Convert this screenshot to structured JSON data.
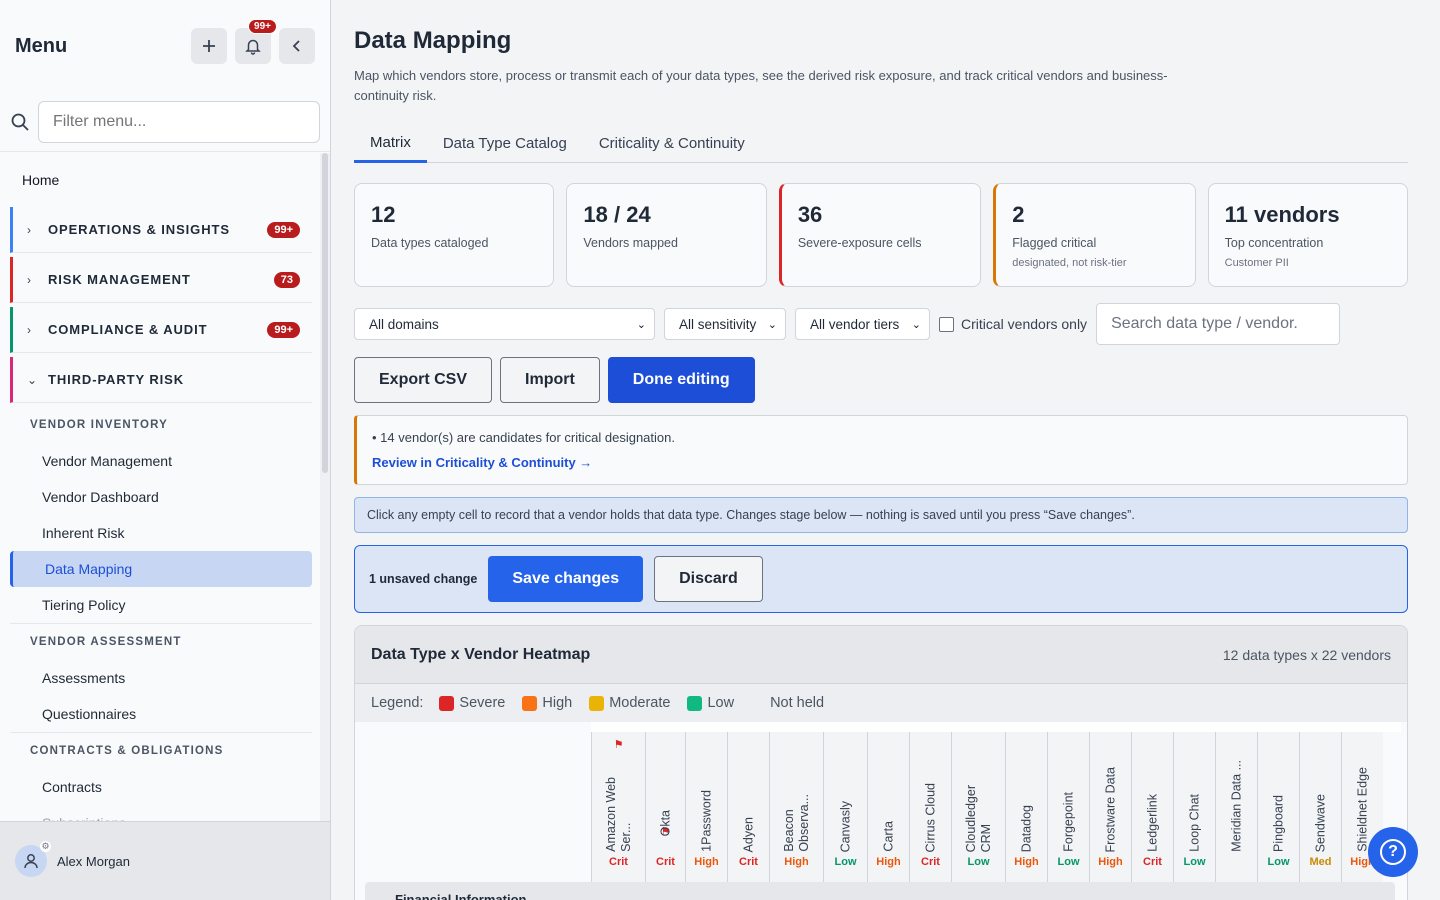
{
  "sidebar": {
    "title": "Menu",
    "notif_badge": "99+",
    "filter_placeholder": "Filter menu...",
    "home": "Home",
    "groups": [
      {
        "label": "OPERATIONS & INSIGHTS",
        "count": "99+",
        "color": "#3b82f6"
      },
      {
        "label": "RISK MANAGEMENT",
        "count": "73",
        "color": "#dc2626"
      },
      {
        "label": "COMPLIANCE & AUDIT",
        "count": "99+",
        "color": "#059669"
      },
      {
        "label": "THIRD-PARTY RISK",
        "count": "",
        "color": "#db2777"
      }
    ],
    "sections": {
      "vendor_inventory": "VENDOR INVENTORY",
      "vendor_assessment": "VENDOR ASSESSMENT",
      "contracts": "CONTRACTS & OBLIGATIONS"
    },
    "items": {
      "vendor_management": "Vendor Management",
      "vendor_dashboard": "Vendor Dashboard",
      "inherent_risk": "Inherent Risk",
      "data_mapping": "Data Mapping",
      "tiering_policy": "Tiering Policy",
      "assessments": "Assessments",
      "questionnaires": "Questionnaires",
      "contracts": "Contracts",
      "subscriptions": "Subscriptions"
    },
    "user": "Alex Morgan"
  },
  "page": {
    "title": "Data Mapping",
    "subtitle": "Map which vendors store, process or transmit each of your data types, see the derived risk exposure, and track critical vendors and business-continuity risk.",
    "tabs": [
      "Matrix",
      "Data Type Catalog",
      "Criticality & Continuity"
    ]
  },
  "stats": [
    {
      "value": "12",
      "label": "Data types cataloged",
      "note": ""
    },
    {
      "value": "18 / 24",
      "label": "Vendors mapped",
      "note": ""
    },
    {
      "value": "36",
      "label": "Severe-exposure cells",
      "note": ""
    },
    {
      "value": "2",
      "label": "Flagged critical",
      "note": "designated, not risk-tier"
    },
    {
      "value": "11 vendors",
      "label": "Top concentration",
      "note": "Customer PII"
    }
  ],
  "filters": {
    "domain": "All domains",
    "sensitivity": "All sensitivity",
    "tiers": "All vendor tiers",
    "critical_only": "Critical vendors only",
    "search_placeholder": "Search data type / vendor."
  },
  "actions": {
    "export": "Export CSV",
    "import": "Import",
    "done": "Done editing"
  },
  "notice": {
    "line": "• 14 vendor(s) are candidates for critical designation.",
    "link": "Review in Criticality & Continuity →"
  },
  "info": "Click any empty cell to record that a vendor holds that data type. Changes stage below — nothing is saved until you press “Save changes”.",
  "unsaved": {
    "label": "1 unsaved change",
    "save": "Save changes",
    "discard": "Discard"
  },
  "heatmap": {
    "title": "Data Type x Vendor Heatmap",
    "meta": "12 data types x 22 vendors",
    "legend_label": "Legend:",
    "legend": [
      {
        "label": "Severe",
        "color": "#dc2626"
      },
      {
        "label": "High",
        "color": "#f97316"
      },
      {
        "label": "Moderate",
        "color": "#eab308"
      },
      {
        "label": "Low",
        "color": "#10b981"
      }
    ],
    "not_held": "Not held",
    "vendors": [
      {
        "name": "Amazon Web\nSer...",
        "tier": "Crit",
        "flag": true
      },
      {
        "name": "Okta",
        "tier": "Crit",
        "flag": true
      },
      {
        "name": "1Password",
        "tier": "High",
        "flag": false
      },
      {
        "name": "Adyen",
        "tier": "Crit",
        "flag": false
      },
      {
        "name": "Beacon\nObserva...",
        "tier": "High",
        "flag": false
      },
      {
        "name": "Canvasly",
        "tier": "Low",
        "flag": false
      },
      {
        "name": "Carta",
        "tier": "High",
        "flag": false
      },
      {
        "name": "Cirrus Cloud",
        "tier": "Crit",
        "flag": false
      },
      {
        "name": "Cloudledger\nCRM",
        "tier": "Low",
        "flag": false
      },
      {
        "name": "Datadog",
        "tier": "High",
        "flag": false
      },
      {
        "name": "Forgepoint",
        "tier": "Low",
        "flag": false
      },
      {
        "name": "Frostware Data",
        "tier": "High",
        "flag": false
      },
      {
        "name": "Ledgerlink",
        "tier": "Crit",
        "flag": false
      },
      {
        "name": "Loop Chat",
        "tier": "Low",
        "flag": false
      },
      {
        "name": "Meridian Data ...",
        "tier": "",
        "flag": false
      },
      {
        "name": "Pingboard",
        "tier": "Low",
        "flag": false
      },
      {
        "name": "Sendwave",
        "tier": "Med",
        "flag": false
      },
      {
        "name": "Shieldnet Edge",
        "tier": "High",
        "flag": false
      }
    ],
    "first_row": "Financial Information"
  },
  "colors": {
    "crit": "#dc2626",
    "high": "#ea580c",
    "med": "#ca8a04",
    "low": "#059669",
    "accent": "#2563eb"
  }
}
